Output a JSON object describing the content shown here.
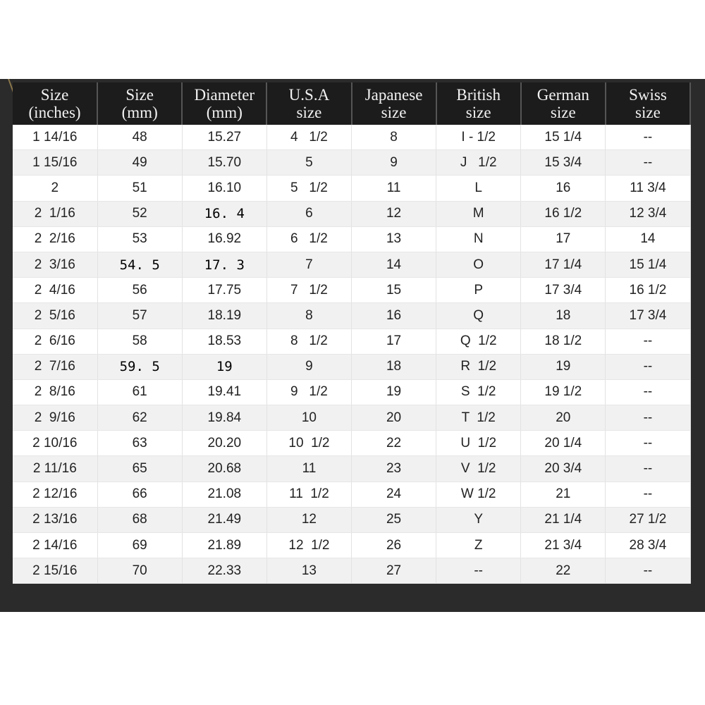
{
  "headers": [
    [
      "Size",
      "(inches)"
    ],
    [
      "Size",
      "(mm)"
    ],
    [
      "Diameter",
      "(mm)"
    ],
    [
      "U.S.A",
      "size"
    ],
    [
      "Japanese",
      "size"
    ],
    [
      "British",
      "size"
    ],
    [
      "German",
      "size"
    ],
    [
      "Swiss",
      "size"
    ]
  ],
  "rows": [
    [
      "1 14/16",
      "48",
      "15.27",
      "4   1/2",
      "8",
      "I - 1/2",
      "15 1/4",
      "--"
    ],
    [
      "1 15/16",
      "49",
      "15.70",
      "5",
      "9",
      "J   1/2",
      "15 3/4",
      "--"
    ],
    [
      "2",
      "51",
      "16.10",
      "5   1/2",
      "11",
      "L",
      "16",
      "11 3/4"
    ],
    [
      "2  1/16",
      "52",
      "16. 4",
      "6",
      "12",
      "M",
      "16 1/2",
      "12 3/4"
    ],
    [
      "2  2/16",
      "53",
      "16.92",
      "6   1/2",
      "13",
      "N",
      "17",
      "14"
    ],
    [
      "2  3/16",
      "54. 5",
      "17. 3",
      "7",
      "14",
      "O",
      "17 1/4",
      "15 1/4"
    ],
    [
      "2  4/16",
      "56",
      "17.75",
      "7   1/2",
      "15",
      "P",
      "17 3/4",
      "16 1/2"
    ],
    [
      "2  5/16",
      "57",
      "18.19",
      "8",
      "16",
      "Q",
      "18",
      "17 3/4"
    ],
    [
      "2  6/16",
      "58",
      "18.53",
      "8   1/2",
      "17",
      "Q  1/2",
      "18 1/2",
      "--"
    ],
    [
      "2  7/16",
      "59. 5",
      "19",
      "9",
      "18",
      "R  1/2",
      "19",
      "--"
    ],
    [
      "2  8/16",
      "61",
      "19.41",
      "9   1/2",
      "19",
      "S  1/2",
      "19 1/2",
      "--"
    ],
    [
      "2  9/16",
      "62",
      "19.84",
      "10",
      "20",
      "T  1/2",
      "20",
      "--"
    ],
    [
      "2 10/16",
      "63",
      "20.20",
      "10  1/2",
      "22",
      "U  1/2",
      "20 1/4",
      "--"
    ],
    [
      "2 11/16",
      "65",
      "20.68",
      "11",
      "23",
      "V  1/2",
      "20 3/4",
      "--"
    ],
    [
      "2 12/16",
      "66",
      "21.08",
      "11  1/2",
      "24",
      "W 1/2",
      "21",
      "--"
    ],
    [
      "2 13/16",
      "68",
      "21.49",
      "12",
      "25",
      "Y",
      "21 1/4",
      "27 1/2"
    ],
    [
      "2 14/16",
      "69",
      "21.89",
      "12  1/2",
      "26",
      "Z",
      "21 3/4",
      "28 3/4"
    ],
    [
      "2 15/16",
      "70",
      "22.33",
      "13",
      "27",
      "--",
      "22",
      "--"
    ]
  ],
  "colors": {
    "header_bg": "#1c1c1c",
    "header_text": "#f2f2f2",
    "band": "#2b2b2b",
    "alt_row": "#f1f1f1"
  }
}
